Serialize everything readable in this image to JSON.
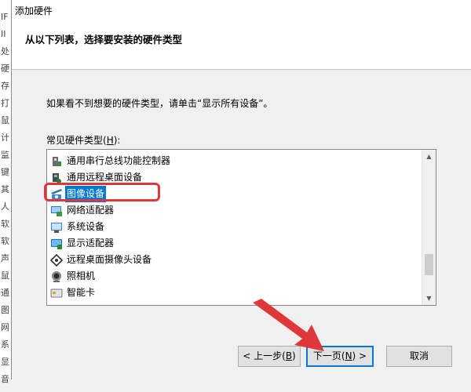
{
  "background_window": {
    "glyphs": [
      "IF",
      "II",
      "处",
      "硬",
      "存",
      "打",
      "鼠",
      "计",
      "监",
      "键",
      "其",
      "人",
      "软",
      "软",
      "声",
      "鼠",
      "通",
      "图",
      "网",
      "系",
      "显",
      "音"
    ]
  },
  "window": {
    "title": "添加硬件"
  },
  "header": {
    "heading": "从以下列表，选择要安装的硬件类型"
  },
  "instruction": "如果看不到想要的硬件类型，请单击“显示所有设备”。",
  "list": {
    "label_prefix": "常见硬件类型(",
    "label_mnemonic": "H",
    "label_suffix": "):",
    "items": [
      {
        "label": "通用串行总线功能控制器",
        "icon": "usb-controller-icon",
        "selected": false
      },
      {
        "label": "通用远程桌面设备",
        "icon": "remote-desktop-device-icon",
        "selected": false
      },
      {
        "label": "图像设备",
        "icon": "imaging-device-icon",
        "selected": true
      },
      {
        "label": "网络适配器",
        "icon": "network-adapter-icon",
        "selected": false
      },
      {
        "label": "系统设备",
        "icon": "system-device-icon",
        "selected": false
      },
      {
        "label": "显示适配器",
        "icon": "display-adapter-icon",
        "selected": false
      },
      {
        "label": "远程桌面摄像头设备",
        "icon": "remote-camera-icon",
        "selected": false
      },
      {
        "label": "照相机",
        "icon": "camera-icon",
        "selected": false
      },
      {
        "label": "智能卡",
        "icon": "smart-card-icon",
        "selected": false
      }
    ],
    "scroll_position": 0.85
  },
  "buttons": {
    "back": {
      "prefix": "< 上一步(",
      "mnemonic": "B",
      "suffix": ")"
    },
    "next": {
      "prefix": "下一页(",
      "mnemonic": "N",
      "suffix": ") >"
    },
    "cancel": {
      "label": "取消"
    }
  },
  "colors": {
    "selection": "#0078d7",
    "annotation": "#e0383a"
  }
}
